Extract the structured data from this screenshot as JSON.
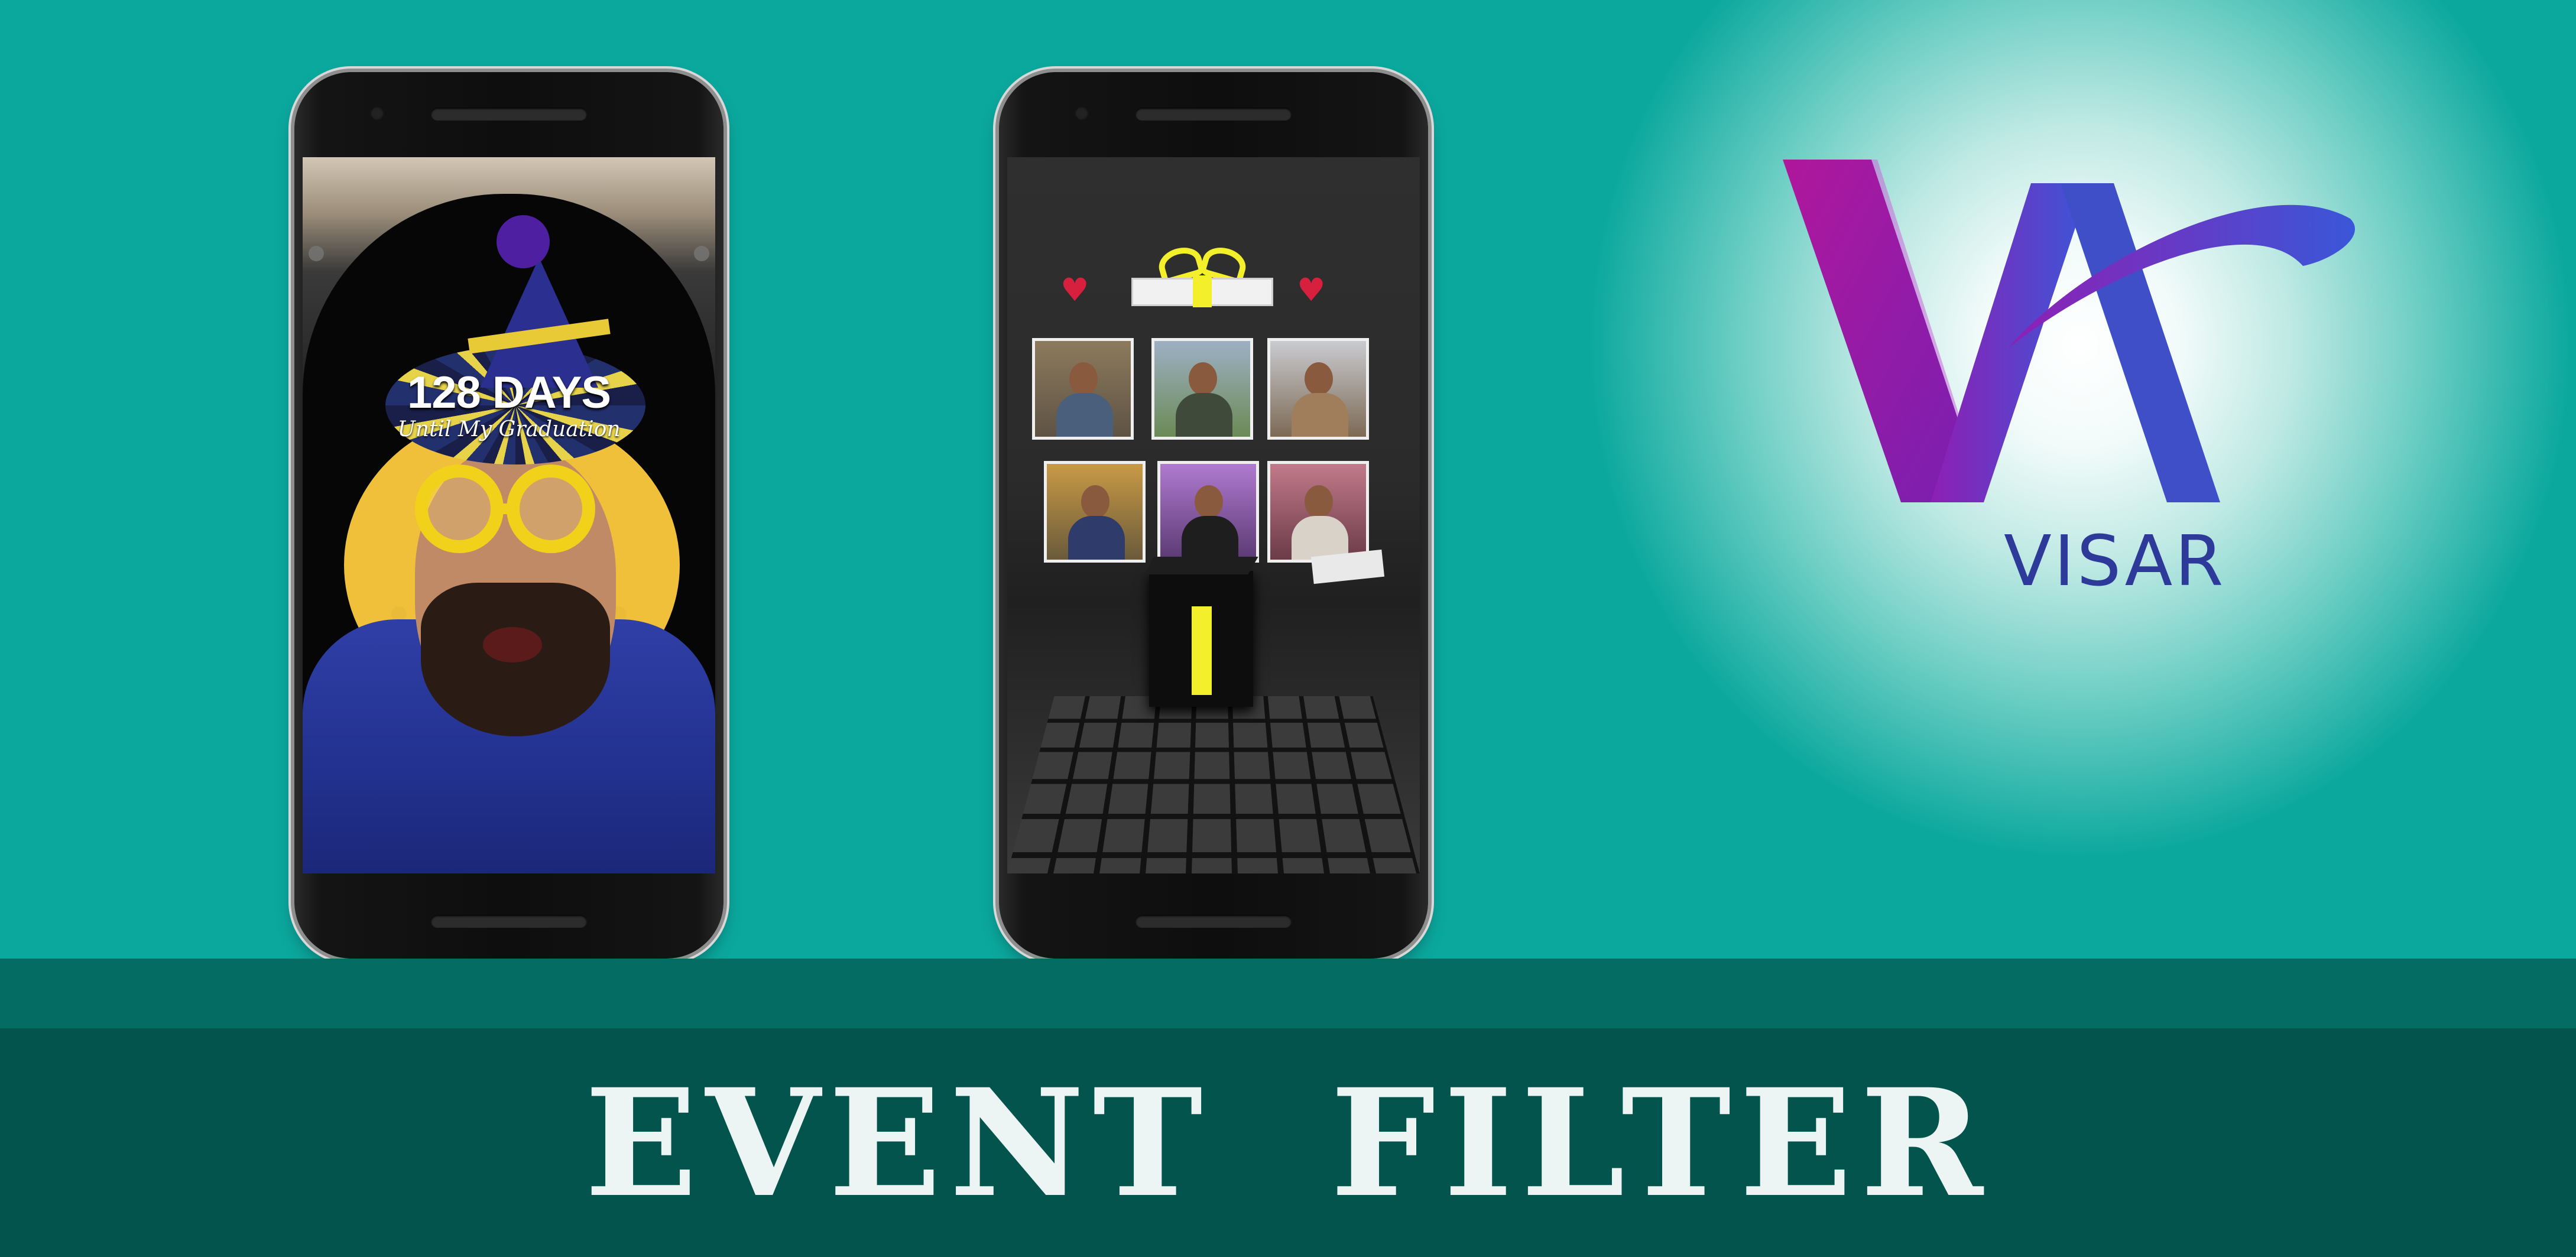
{
  "banner": {
    "title": "EVENT  FILTER"
  },
  "logo": {
    "name": "VISAR",
    "icon": "visar-va-logo-icon",
    "colors": {
      "purple": "#8e1fb4",
      "magenta": "#b0179c",
      "blue": "#3a57d8"
    }
  },
  "phone_left": {
    "filter_days": "128 DAYS",
    "filter_subtitle": "Until My Graduation"
  },
  "phone_right": {
    "photos_count_top_row": 3,
    "photos_count_bottom_row": 3
  },
  "colors": {
    "background": "#0ba89e",
    "band_dark": "#03544c",
    "band_mid": "#046c63",
    "title_text": "#ecf5f3"
  }
}
